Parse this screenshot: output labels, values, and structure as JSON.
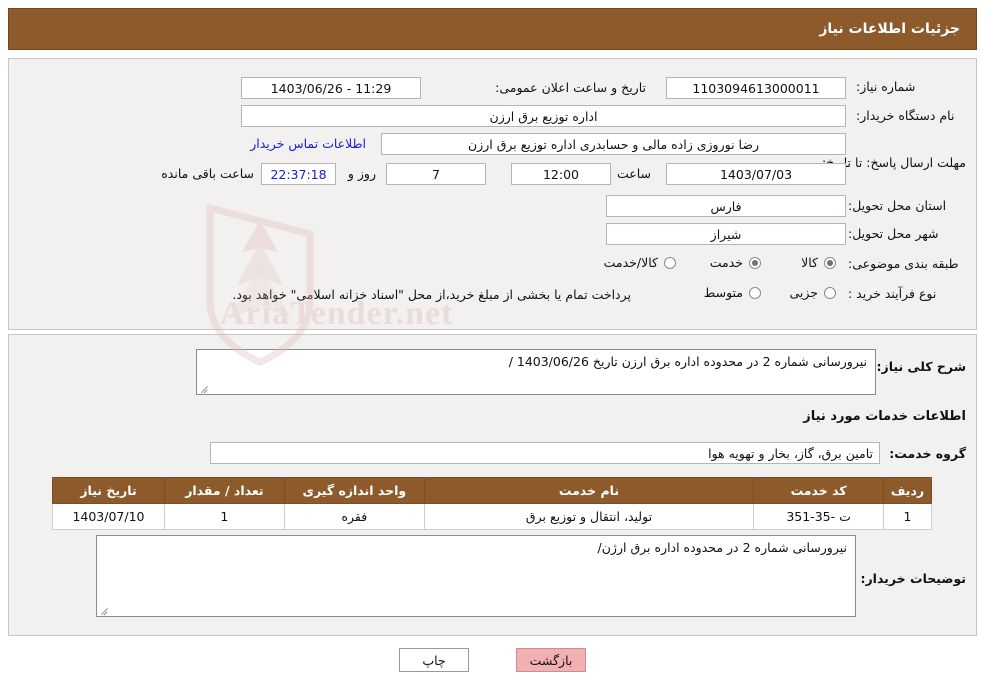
{
  "header": {
    "title": "جزئیات اطلاعات نیاز"
  },
  "watermark": {
    "text": "AriaTender.net"
  },
  "form": {
    "need_number_label": "شماره نیاز:",
    "need_number_value": "1103094613000011",
    "announce_datetime_label": "تاریخ و ساعت اعلان عمومی:",
    "announce_datetime_value": "11:29 - 1403/06/26",
    "buyer_org_label": "نام دستگاه خریدار:",
    "buyer_org_value": "اداره توزیع برق ارزن",
    "buyer_contact_label": "اطلاعات تماس خریدار",
    "buyer_person_value": "رضا نوروزی زاده مالی و حسابدری اداره توزیع برق ارزن",
    "deadline_label": "مهلت ارسال پاسخ: تا تاریخ:",
    "deadline_date": "1403/07/03",
    "deadline_time_label": "ساعت",
    "deadline_time": "12:00",
    "remaining_days": "7",
    "remaining_days_label": "روز و",
    "remaining_clock": "22:37:18",
    "remaining_suffix": "ساعت باقی مانده",
    "province_label": "استان محل تحویل:",
    "province_value": "فارس",
    "city_label": "شهر محل تحویل:",
    "city_value": "شیراز",
    "category_label": "طبقه بندی موضوعی:",
    "category_options": [
      {
        "label": "کالا",
        "selected": true
      },
      {
        "label": "خدمت",
        "selected": false
      },
      {
        "label": "کالا/خدمت",
        "selected": false
      }
    ],
    "process_label": "نوع فرآیند خرید :",
    "process_options": [
      {
        "label": "جزیی",
        "selected": false
      },
      {
        "label": "متوسط",
        "selected": false
      }
    ],
    "process_note": "پرداخت تمام یا بخشی از مبلغ خرید،از محل \"اسناد خزانه اسلامی\" خواهد بود."
  },
  "need_summary": {
    "label": "شرح کلی نیاز:",
    "value": "نیرورسانی شماره 2 در محدوده اداره برق ارزن تاریخ 1403/06/26 /"
  },
  "services": {
    "section_title": "اطلاعات خدمات مورد نیاز",
    "group_label": "گروه خدمت:",
    "group_value": "تامین برق، گاز، بخار و تهویه هوا",
    "columns": [
      "ردیف",
      "کد خدمت",
      "نام خدمت",
      "واحد اندازه گیری",
      "تعداد / مقدار",
      "تاریخ نیاز"
    ],
    "rows": [
      {
        "row": "1",
        "code": "ت -35-351",
        "name": "تولید، انتقال و توزیع برق",
        "unit": "فقره",
        "qty": "1",
        "date": "1403/07/10"
      }
    ]
  },
  "buyer_notes": {
    "label": "توضیحات خریدار:",
    "value": "نیرورسانی شماره 2 در محدوده اداره برق ارژن/"
  },
  "footer": {
    "print_label": "چاپ",
    "back_label": "بازگشت"
  }
}
